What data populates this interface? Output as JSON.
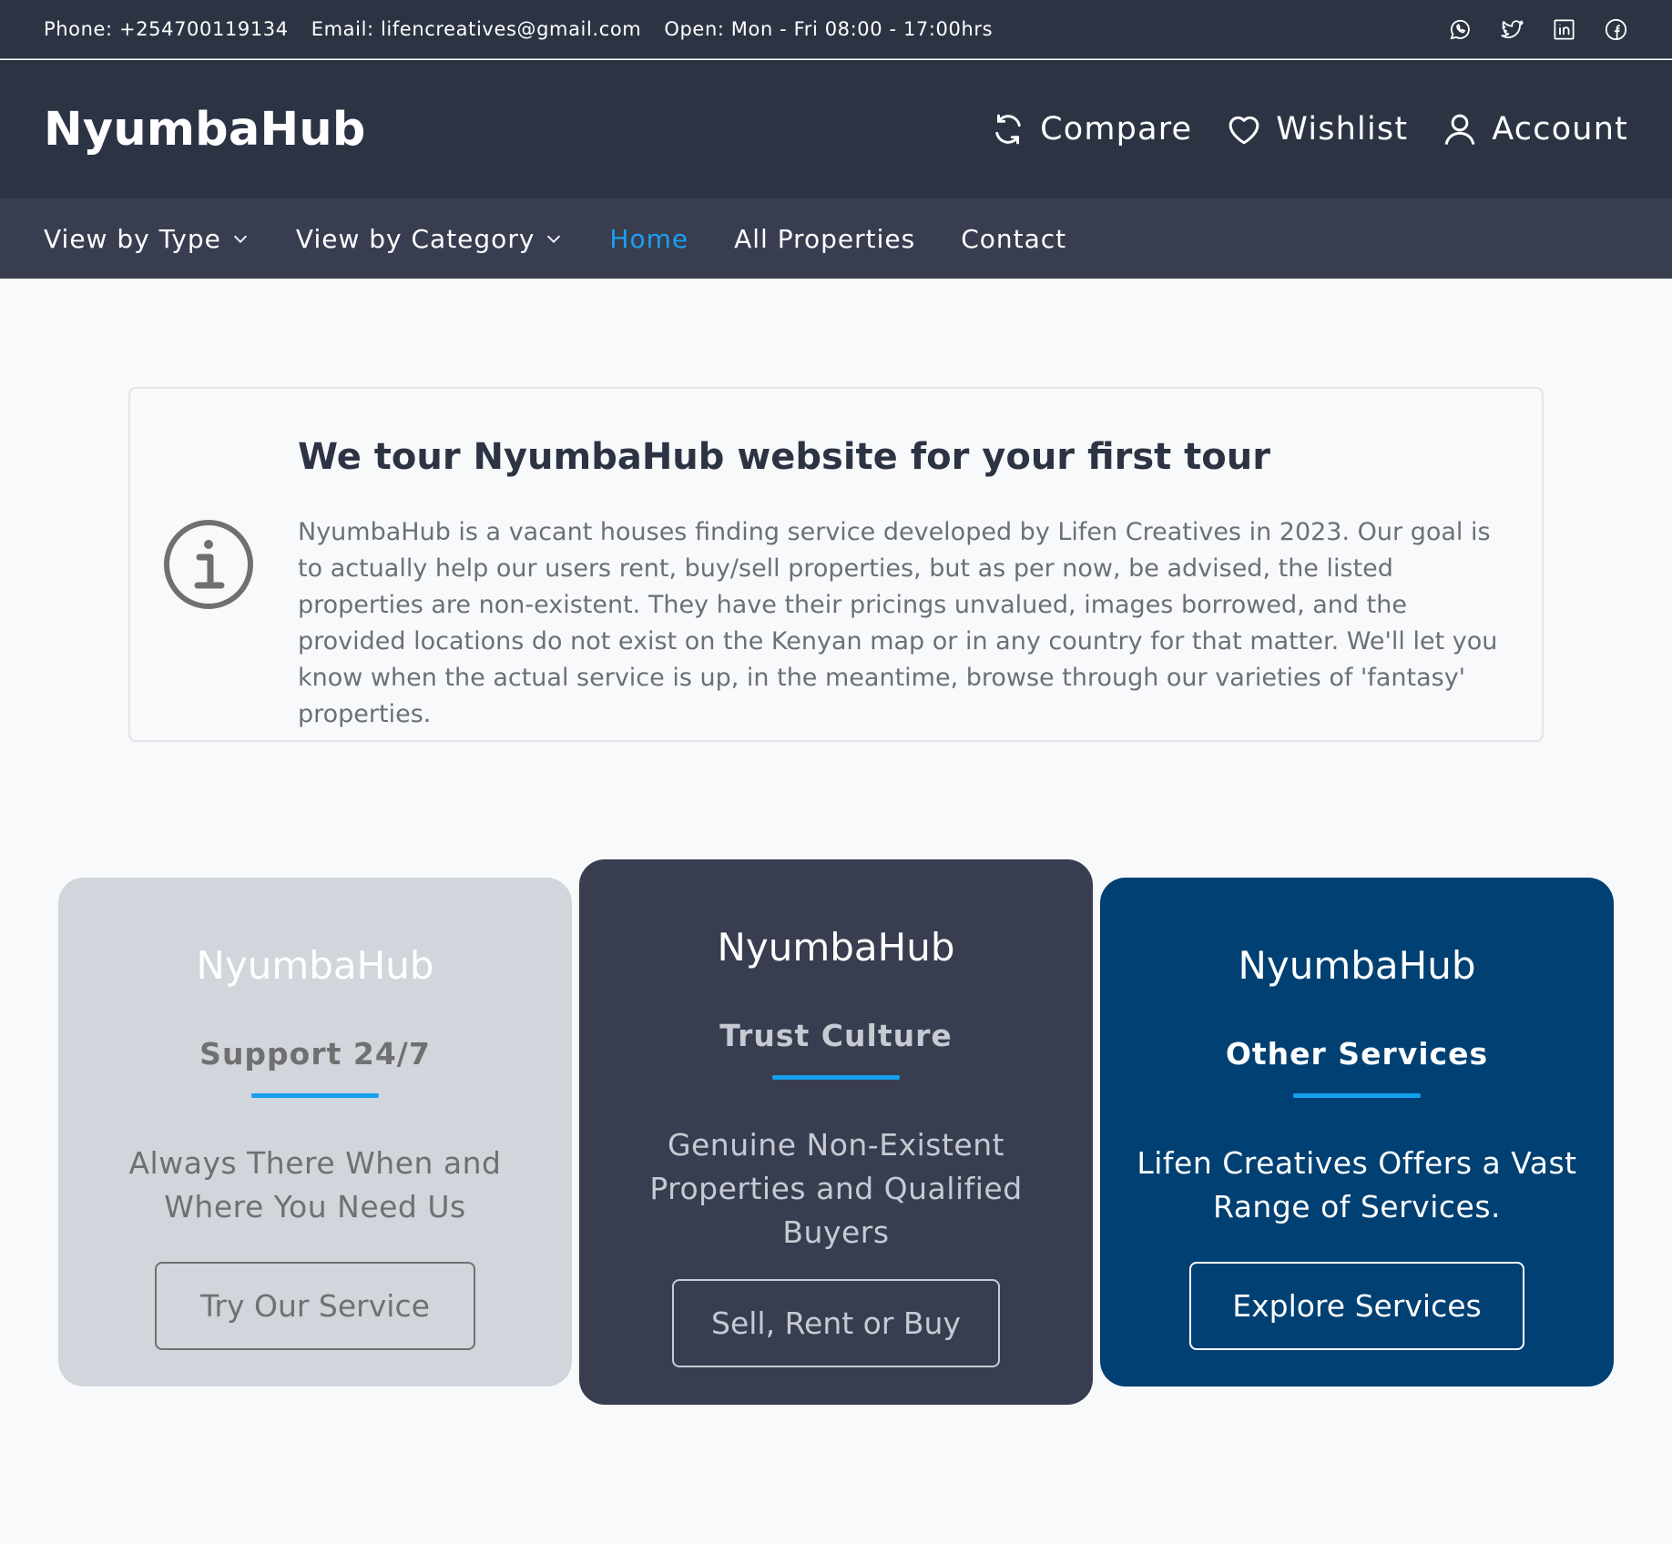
{
  "topbar": {
    "phone": "Phone: +254700119134",
    "email": "Email: lifencreatives@gmail.com",
    "hours": "Open: Mon - Fri 08:00 - 17:00hrs",
    "social_icons": [
      "whatsapp-icon",
      "twitter-icon",
      "linkedin-icon",
      "facebook-icon"
    ]
  },
  "header": {
    "logo": "NyumbaHub",
    "compare": "Compare",
    "wishlist": "Wishlist",
    "account": "Account"
  },
  "nav": {
    "items": [
      {
        "label": "View by Type",
        "dropdown": true
      },
      {
        "label": "View by Category",
        "dropdown": true
      },
      {
        "label": "Home",
        "active": true
      },
      {
        "label": "All Properties"
      },
      {
        "label": "Contact"
      }
    ]
  },
  "notice": {
    "title": "We tour NyumbaHub website for your first tour",
    "body": "NyumbaHub is a vacant houses finding service developed by Lifen Creatives in 2023. Our goal is to actually help our users rent, buy/sell properties, but as per now, be advised, the listed properties are non-existent. They have their pricings unvalued, images borrowed, and the provided locations do not exist on the Kenyan map or in any country for that matter. We'll let you know when the actual service is up, in the meantime, browse through our varieties of 'fantasy' properties."
  },
  "cards": [
    {
      "brand": "NyumbaHub",
      "title": "Support 24/7",
      "desc": "Always There When and Where You Need Us",
      "button": "Try Our Service"
    },
    {
      "brand": "NyumbaHub",
      "title": "Trust Culture",
      "desc": "Genuine Non-Existent Properties and Qualified Buyers",
      "button": "Sell, Rent or Buy"
    },
    {
      "brand": "NyumbaHub",
      "title": "Other Services",
      "desc": "Lifen Creatives Offers a Vast Range of Services.",
      "button": "Explore Services"
    }
  ],
  "colors": {
    "header_bg": "#2c3444",
    "nav_bg": "#383e50",
    "accent": "#1aa0f0",
    "card1_bg": "#d1d5dc",
    "card2_bg": "#383e50",
    "card3_bg": "#004073"
  }
}
